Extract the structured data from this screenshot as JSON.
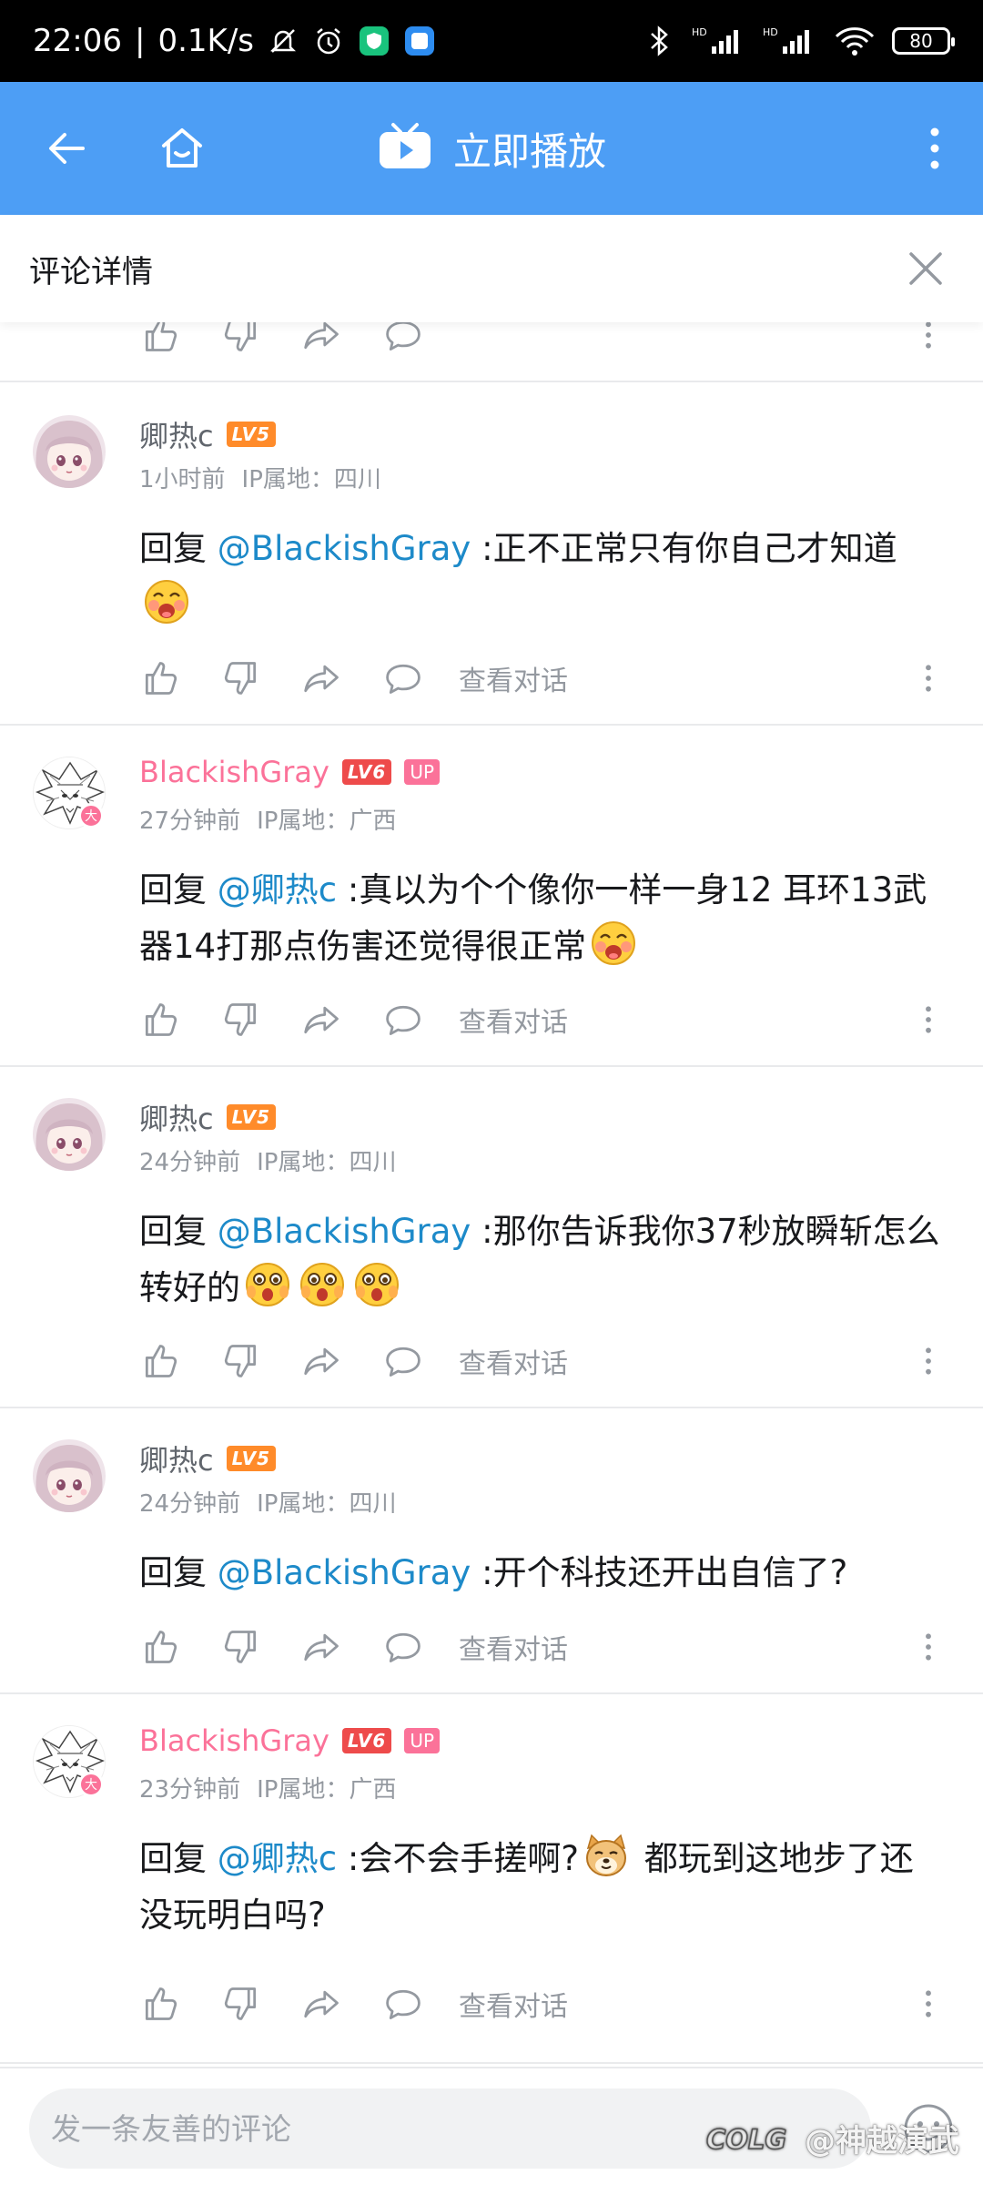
{
  "status_bar": {
    "time": "22:06",
    "speed": "0.1K/s",
    "battery": "80"
  },
  "app_bar": {
    "title": "立即播放"
  },
  "panel": {
    "title": "评论详情"
  },
  "comments": [
    {
      "name": "卿热c",
      "level": "LV5",
      "time": "1小时前",
      "ip": "IP属地：四川",
      "reply_prefix": "回复 ",
      "mention": "@BlackishGray",
      "text": " :正不正常只有你自己才知道",
      "view_conversation": "查看对话"
    },
    {
      "name": "BlackishGray",
      "level": "LV6",
      "up": "UP",
      "avatar_badge": "大",
      "time": "27分钟前",
      "ip": "IP属地：广西",
      "reply_prefix": "回复 ",
      "mention": "@卿热c",
      "text": " :真以为个个像你一样一身12 耳环13武器14打那点伤害还觉得很正常",
      "view_conversation": "查看对话"
    },
    {
      "name": "卿热c",
      "level": "LV5",
      "time": "24分钟前",
      "ip": "IP属地：四川",
      "reply_prefix": "回复 ",
      "mention": "@BlackishGray",
      "text": " :那你告诉我你37秒放瞬斩怎么转好的",
      "view_conversation": "查看对话"
    },
    {
      "name": "卿热c",
      "level": "LV5",
      "time": "24分钟前",
      "ip": "IP属地：四川",
      "reply_prefix": "回复 ",
      "mention": "@BlackishGray",
      "text": " :开个科技还开出自信了?",
      "view_conversation": "查看对话"
    },
    {
      "name": "BlackishGray",
      "level": "LV6",
      "up": "UP",
      "avatar_badge": "大",
      "time": "23分钟前",
      "ip": "IP属地：广西",
      "reply_prefix": "回复 ",
      "mention": "@卿热c",
      "text_a": " :会不会手搓啊?",
      "text_b": " 都玩到这地步了还没玩明白吗?",
      "view_conversation": "查看对话"
    }
  ],
  "bottom_bar": {
    "placeholder": "发一条友善的评论",
    "watermark": "@神越演武"
  },
  "colors": {
    "app_bar": "#4d9ef5",
    "mention": "#1d8ac9",
    "vip_name": "#fb7299",
    "lv5": "#ff8b2a",
    "lv6": "#ee4b4b"
  }
}
